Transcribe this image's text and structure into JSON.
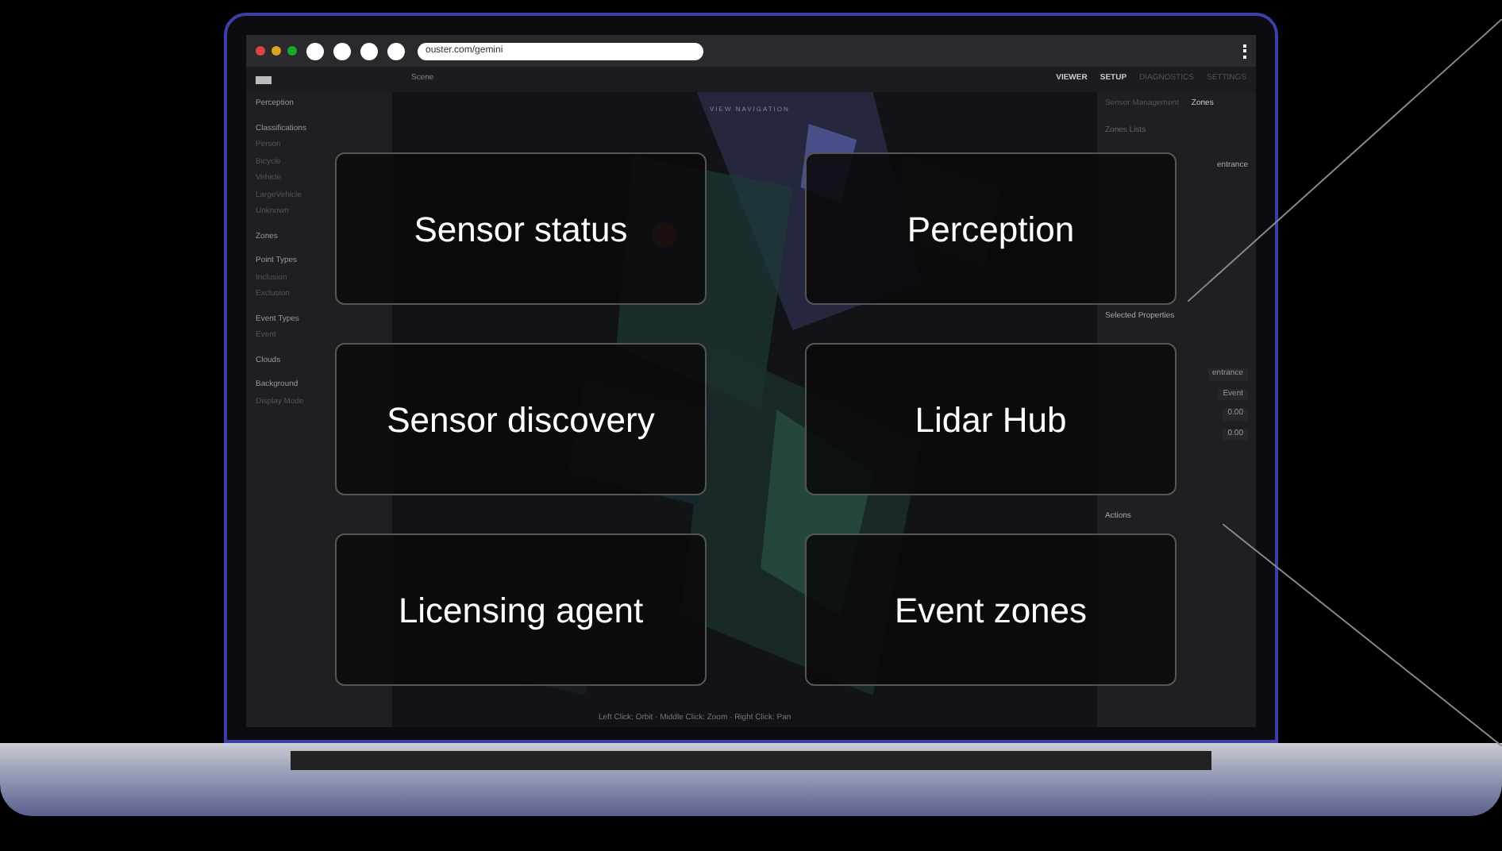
{
  "browser": {
    "url": "ouster.com/gemini"
  },
  "app": {
    "breadcrumb": "Scene",
    "nav": [
      {
        "label": "VIEWER",
        "selected": true
      },
      {
        "label": "SETUP",
        "selected": true
      },
      {
        "label": "DIAGNOSTICS",
        "selected": false
      },
      {
        "label": "SETTINGS",
        "selected": false
      }
    ],
    "sidebar": [
      {
        "title": "Perception"
      },
      {
        "title": "Classifications",
        "items": [
          "Person",
          "Bicycle",
          "Vehicle",
          "LargeVehicle",
          "Unknown"
        ]
      },
      {
        "title": "Zones"
      },
      {
        "title": "Point Types",
        "items": [
          "Inclusion",
          "Exclusion"
        ]
      },
      {
        "title": "Event Types",
        "items": [
          "Event"
        ]
      },
      {
        "title": "Clouds"
      },
      {
        "title": "Background",
        "items": [
          "Display Mode"
        ]
      }
    ],
    "viewport_label": "VIEW NAVIGATION",
    "right_tabs": [
      {
        "label": "Sensor Management",
        "selected": false
      },
      {
        "label": "Zones",
        "selected": true
      }
    ],
    "right_panel": {
      "list_title": "Zones Lists",
      "zone_tag": "entrance",
      "properties_title": "Selected Properties",
      "fields": [
        {
          "value": "entrance"
        },
        {
          "value": "Event"
        },
        {
          "value": "0.00"
        },
        {
          "value": "0.00"
        }
      ],
      "actions_title": "Actions"
    },
    "hint": "Left Click: Orbit · Middle Click: Zoom · Right Click: Pan"
  },
  "cards": [
    {
      "label": "Sensor status"
    },
    {
      "label": "Perception"
    },
    {
      "label": "Sensor discovery"
    },
    {
      "label": "Lidar Hub"
    },
    {
      "label": "Licensing agent"
    },
    {
      "label": "Event zones"
    }
  ]
}
